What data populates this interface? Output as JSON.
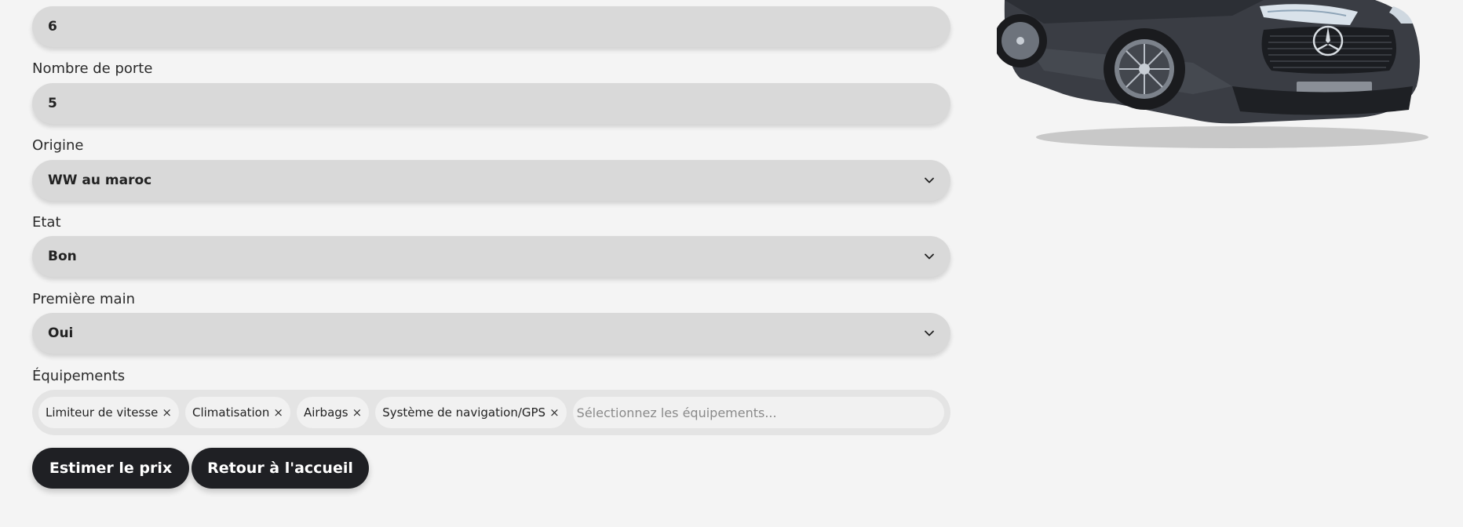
{
  "form": {
    "top_field": {
      "value": "6"
    },
    "doors": {
      "label": "Nombre de porte",
      "value": "5"
    },
    "origin": {
      "label": "Origine",
      "value": "WW au maroc"
    },
    "state": {
      "label": "Etat",
      "value": "Bon"
    },
    "first_hand": {
      "label": "Première main",
      "value": "Oui"
    },
    "equipment": {
      "label": "Équipements",
      "tags": [
        {
          "label": "Limiteur de vitesse",
          "remove": "×"
        },
        {
          "label": "Climatisation",
          "remove": "×"
        },
        {
          "label": "Airbags",
          "remove": "×"
        },
        {
          "label": "Système de navigation/GPS",
          "remove": "×"
        }
      ],
      "placeholder": "Sélectionnez les équipements..."
    }
  },
  "actions": {
    "estimate_label": "Estimer le prix",
    "home_label": "Retour à l'accueil"
  },
  "image": {
    "subject": "car-image",
    "color": "#3a3d44"
  },
  "colors": {
    "background": "#f4f4f4",
    "control_bg": "#d9d9d9",
    "button_bg": "#1f2024"
  }
}
